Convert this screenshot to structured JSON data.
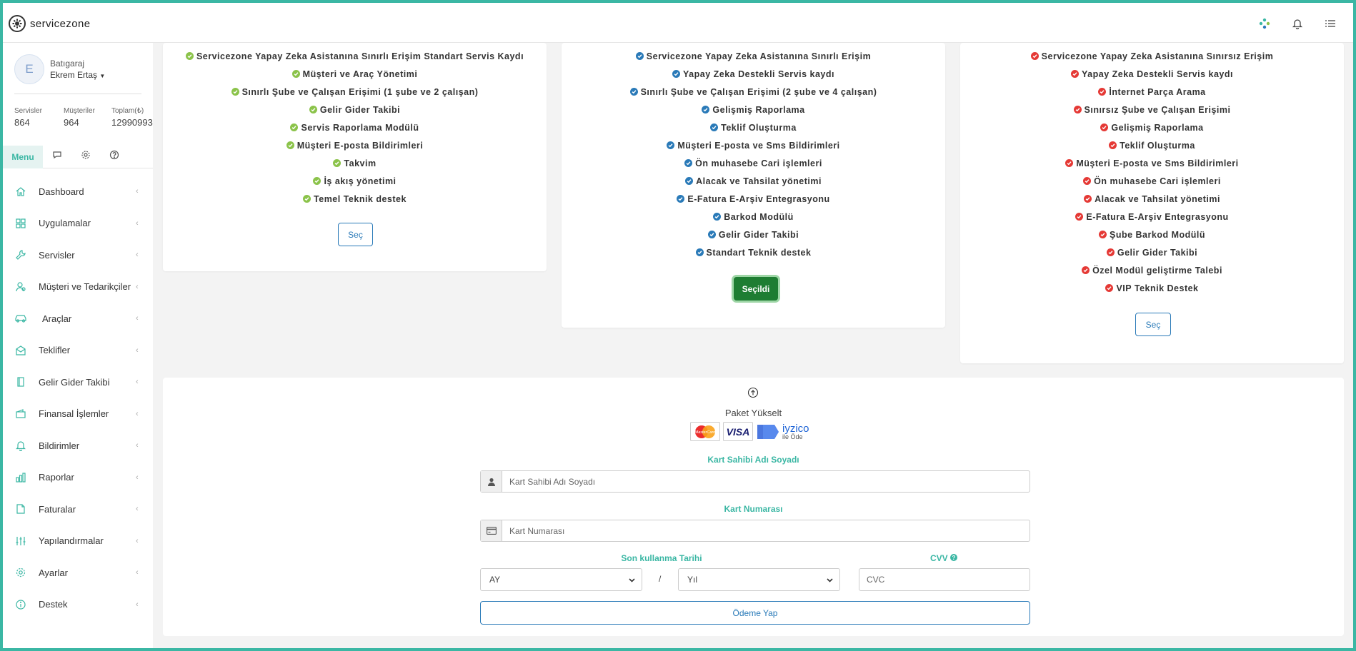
{
  "app": {
    "brand": "servicezone"
  },
  "colors": {
    "accent": "#3bb7a4",
    "green_check": "#8bc34a",
    "blue_check": "#2a7ab8",
    "red_check": "#e53935",
    "selected_button": "#1e7d32"
  },
  "topbar": {
    "icons": [
      "apps-icon",
      "bell-icon",
      "list-icon"
    ]
  },
  "sidebar": {
    "org_name": "Batıgaraj",
    "user_name": "Ekrem Ertaş",
    "avatar_letter": "E",
    "stats": [
      {
        "label": "Servisler",
        "value": "864"
      },
      {
        "label": "Müşteriler",
        "value": "964"
      },
      {
        "label": "Toplam(₺)",
        "value": "12990993"
      }
    ],
    "menu_tab": "Menu",
    "items": [
      {
        "label": "Dashboard",
        "icon": "home-icon"
      },
      {
        "label": "Uygulamalar",
        "icon": "grid-icon"
      },
      {
        "label": "Servisler",
        "icon": "wrench-icon"
      },
      {
        "label": "Müşteri ve Tedarikçiler",
        "icon": "users-icon"
      },
      {
        "label": "Araçlar",
        "icon": "car-icon"
      },
      {
        "label": "Teklifler",
        "icon": "envelope-icon"
      },
      {
        "label": "Gelir Gider Takibi",
        "icon": "book-icon"
      },
      {
        "label": "Finansal İşlemler",
        "icon": "wallet-icon"
      },
      {
        "label": "Bildirimler",
        "icon": "bell-icon"
      },
      {
        "label": "Raporlar",
        "icon": "bar-chart-icon"
      },
      {
        "label": "Faturalar",
        "icon": "file-icon"
      },
      {
        "label": "Yapılandırmalar",
        "icon": "sliders-icon"
      },
      {
        "label": "Ayarlar",
        "icon": "gear-icon"
      },
      {
        "label": "Destek",
        "icon": "info-icon"
      }
    ]
  },
  "plans": [
    {
      "check_color": "#8bc34a",
      "features": [
        "Servicezone Yapay Zeka Asistanına Sınırlı Erişim Standart Servis Kaydı",
        "Müşteri ve Araç Yönetimi",
        "Sınırlı Şube ve Çalışan Erişimi (1 şube ve 2 çalışan)",
        "Gelir Gider Takibi",
        "Servis Raporlama Modülü",
        "Müşteri E-posta Bildirimleri",
        "Takvim",
        "İş akış yönetimi",
        "Temel Teknik destek"
      ],
      "button_label": "Seç",
      "selected": false
    },
    {
      "check_color": "#2a7ab8",
      "features": [
        "Servicezone Yapay Zeka Asistanına Sınırlı Erişim",
        "Yapay Zeka Destekli Servis kaydı",
        "Sınırlı Şube ve Çalışan Erişimi (2 şube ve 4 çalışan)",
        "Gelişmiş Raporlama",
        "Teklif Oluşturma",
        "Müşteri E-posta ve Sms Bildirimleri",
        "Ön muhasebe Cari işlemleri",
        "Alacak ve Tahsilat yönetimi",
        "E-Fatura E-Arşiv Entegrasyonu",
        "Barkod Modülü",
        "Gelir Gider Takibi",
        "Standart Teknik destek"
      ],
      "button_label": "Seçildi",
      "selected": true
    },
    {
      "check_color": "#e53935",
      "features": [
        "Servicezone Yapay Zeka Asistanına Sınırsız Erişim",
        "Yapay Zeka Destekli Servis kaydı",
        "İnternet Parça Arama",
        "Sınırsız Şube ve Çalışan Erişimi",
        "Gelişmiş Raporlama",
        "Teklif Oluşturma",
        "Müşteri E-posta ve Sms Bildirimleri",
        "Ön muhasebe Cari işlemleri",
        "Alacak ve Tahsilat yönetimi",
        "E-Fatura E-Arşiv Entegrasyonu",
        "Şube Barkod Modülü",
        "Gelir Gider Takibi",
        "Özel Modül geliştirme Talebi",
        "VIP Teknik Destek"
      ],
      "button_label": "Seç",
      "selected": false
    }
  ],
  "payment": {
    "title": "Paket Yükselt",
    "logos": {
      "mastercard": "MasterCard",
      "visa": "VISA",
      "iyzico": "iyzico",
      "iyzico_sub": "ile Öde"
    },
    "card_holder_label": "Kart Sahibi Adı Soyadı",
    "card_holder_placeholder": "Kart Sahibi Adı Soyadı",
    "card_number_label": "Kart Numarası",
    "card_number_placeholder": "Kart Numarası",
    "expiry_label": "Son kullanma Tarihi",
    "month_value": "AY",
    "year_value": "Yıl",
    "separator": "/",
    "cvv_label": "CVV",
    "cvc_placeholder": "CVC",
    "submit_label": "Ödeme Yap"
  }
}
